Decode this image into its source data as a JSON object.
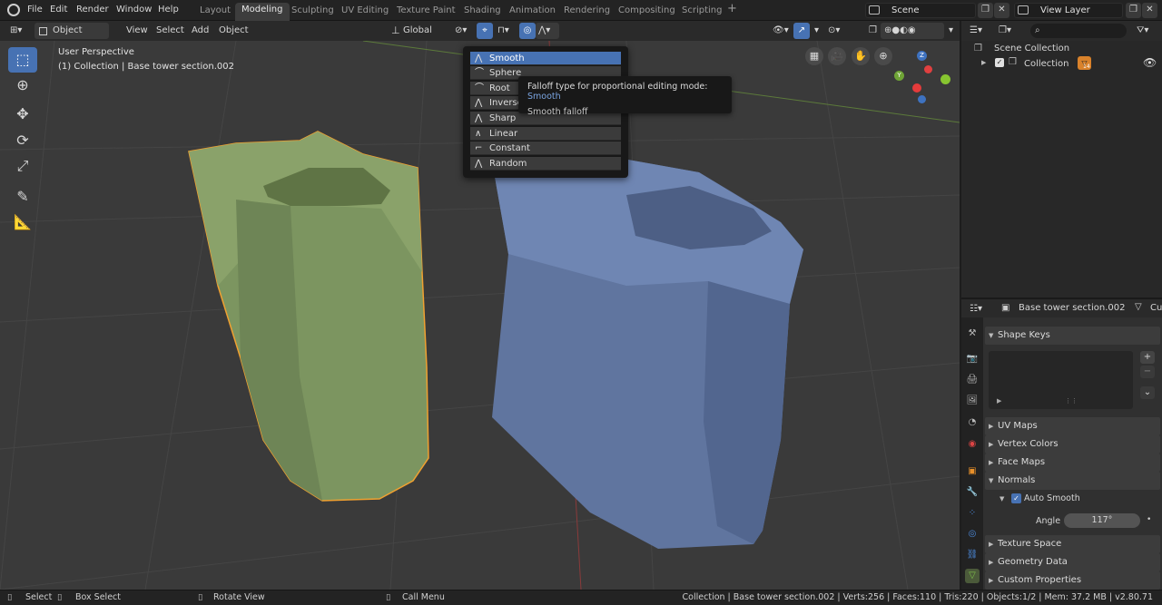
{
  "menu": {
    "file": "File",
    "edit": "Edit",
    "render": "Render",
    "window": "Window",
    "help": "Help"
  },
  "workspaces": [
    "Layout",
    "Modeling",
    "Sculpting",
    "UV Editing",
    "Texture Paint",
    "Shading",
    "Animation",
    "Rendering",
    "Compositing",
    "Scripting"
  ],
  "active_workspace": "Modeling",
  "scene": {
    "name": "Scene",
    "view_layer": "View Layer"
  },
  "header": {
    "mode": "Object Mode",
    "view": "View",
    "select": "Select",
    "add": "Add",
    "object": "Object",
    "orientation": "Global"
  },
  "viewport": {
    "perspective": "User Perspective",
    "collection_info": "(1) Collection | Base tower section.002"
  },
  "falloff_menu": {
    "items": [
      "Smooth",
      "Sphere",
      "Root",
      "Inverse Square",
      "Sharp",
      "Linear",
      "Constant",
      "Random"
    ],
    "items_visible": [
      "Smooth",
      "Sphere",
      "Root",
      "Inverse",
      "Sharp",
      "Linear",
      "Constant",
      "Random"
    ],
    "selected": "Smooth"
  },
  "tooltip": {
    "line1": "Falloff type for proportional editing mode:",
    "value": "Smooth",
    "line2": "Smooth falloff"
  },
  "outliner": {
    "search_placeholder": "",
    "scene_collection": "Scene Collection",
    "collection": "Collection",
    "badge": "14"
  },
  "properties": {
    "object_name": "Base tower section.002",
    "data_name": "Cu",
    "panels": {
      "shape_keys": "Shape Keys",
      "uv_maps": "UV Maps",
      "vertex_colors": "Vertex Colors",
      "face_maps": "Face Maps",
      "normals": "Normals",
      "auto_smooth": "Auto Smooth",
      "angle_label": "Angle",
      "angle_value": "117°",
      "texture_space": "Texture Space",
      "geometry_data": "Geometry Data",
      "custom_properties": "Custom Properties"
    }
  },
  "statusbar": {
    "select": "Select",
    "box_select": "Box Select",
    "rotate_view": "Rotate View",
    "call_menu": "Call Menu",
    "info": "Collection | Base tower section.002 | Verts:256 | Faces:110 | Tris:220 | Objects:1/2 | Mem: 37.2 MB | v2.80.71"
  },
  "colors": {
    "accent": "#4772b3",
    "selected_object": "#8aa26a",
    "other_object": "#6379a8",
    "outline": "#f0a030"
  },
  "gizmo": {
    "z": "Z",
    "y": "Y"
  }
}
